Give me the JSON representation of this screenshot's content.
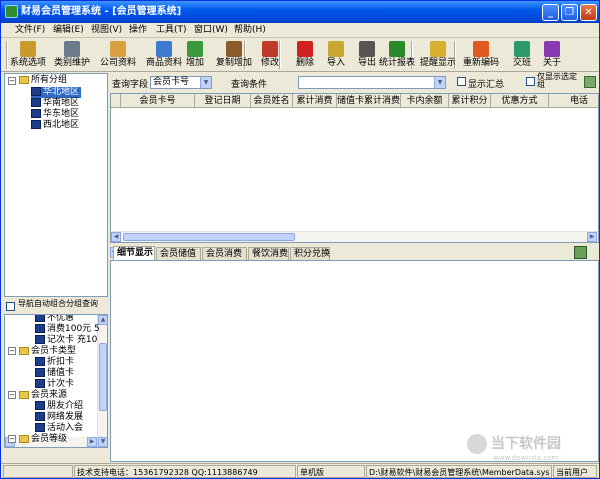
{
  "window": {
    "title": "财易会员管理系统 - [会员管理系统]",
    "minimize_label": "_",
    "restore_label": "❐",
    "close_label": "✕"
  },
  "menu": [
    "文件(F)",
    "编辑(E)",
    "视图(V)",
    "操作",
    "工具(T)",
    "窗口(W)",
    "帮助(H)"
  ],
  "toolbar": [
    {
      "label": "系统选项",
      "icon": "key-icon",
      "color": "#c89a2a"
    },
    {
      "label": "类别维护",
      "icon": "tools-icon",
      "color": "#6b7b8c"
    },
    {
      "label": "公司资料",
      "icon": "company-icon",
      "color": "#d8a040"
    },
    {
      "label": "商品资料",
      "icon": "goods-icon",
      "color": "#3c7bd0"
    },
    {
      "label": "增加",
      "icon": "add-user-icon",
      "color": "#3a9a3a"
    },
    {
      "label": "复制增加",
      "icon": "copy-add-icon",
      "color": "#8a5a2a"
    },
    {
      "label": "修改",
      "icon": "edit-pencil-icon",
      "color": "#c03a2a"
    },
    {
      "label": "删除",
      "icon": "delete-x-icon",
      "color": "#d02020"
    },
    {
      "label": "导入",
      "icon": "import-icon",
      "color": "#c8a830"
    },
    {
      "label": "导出",
      "icon": "export-printer-icon",
      "color": "#555555"
    },
    {
      "label": "统计报表",
      "icon": "bar-chart-icon",
      "color": "#2a8a2a"
    },
    {
      "label": "提醒显示",
      "icon": "reminder-icon",
      "color": "#d8b030"
    },
    {
      "label": "重新编码",
      "icon": "recode-icon",
      "color": "#e05a20"
    },
    {
      "label": "交班",
      "icon": "shift-handover-icon",
      "color": "#2a9a6a"
    },
    {
      "label": "关于",
      "icon": "help-question-icon",
      "color": "#8a3ab0"
    }
  ],
  "tree_top": {
    "root": "所有分组",
    "items": [
      "华北地区",
      "华南地区",
      "华东地区",
      "西北地区"
    ]
  },
  "nav_auto": "导航自动组合分组查询",
  "tree_bottom": [
    {
      "label": "不优惠",
      "level": 2
    },
    {
      "label": "消费100元 5",
      "level": 2
    },
    {
      "label": "记次卡 充10",
      "level": 2
    },
    {
      "label": "会员卡类型",
      "level": 1
    },
    {
      "label": "折扣卡",
      "level": 2
    },
    {
      "label": "储值卡",
      "level": 2
    },
    {
      "label": "计次卡",
      "level": 2
    },
    {
      "label": "会员来源",
      "level": 1
    },
    {
      "label": "朋友介绍",
      "level": 2
    },
    {
      "label": "网络发展",
      "level": 2
    },
    {
      "label": "活动入会",
      "level": 2
    },
    {
      "label": "会员等级",
      "level": 1
    }
  ],
  "query": {
    "field_label": "查询字段",
    "field_value": "会员卡号",
    "cond_label": "查询条件",
    "cond_value": "",
    "show_summary": "显示汇总",
    "show_selected": "仅显示选定组"
  },
  "columns": [
    "会员卡号",
    "登记日期",
    "会员姓名",
    "累计消费",
    "储值卡累计消费",
    "卡内余额",
    "累计积分",
    "优惠方式",
    "电话"
  ],
  "tabs": [
    "细节显示",
    "会员储值",
    "会员消费",
    "餐饮消费",
    "积分兑换"
  ],
  "status": {
    "phone": "技术支持电话：15361792328 QQ:1113886749",
    "mode": "单机版",
    "path": "D:\\财易软件\\财易会员管理系统\\MemberData.sys",
    "user": "当前用户"
  },
  "watermark": {
    "text": "当下软件园",
    "url": "www.downxia.com"
  }
}
